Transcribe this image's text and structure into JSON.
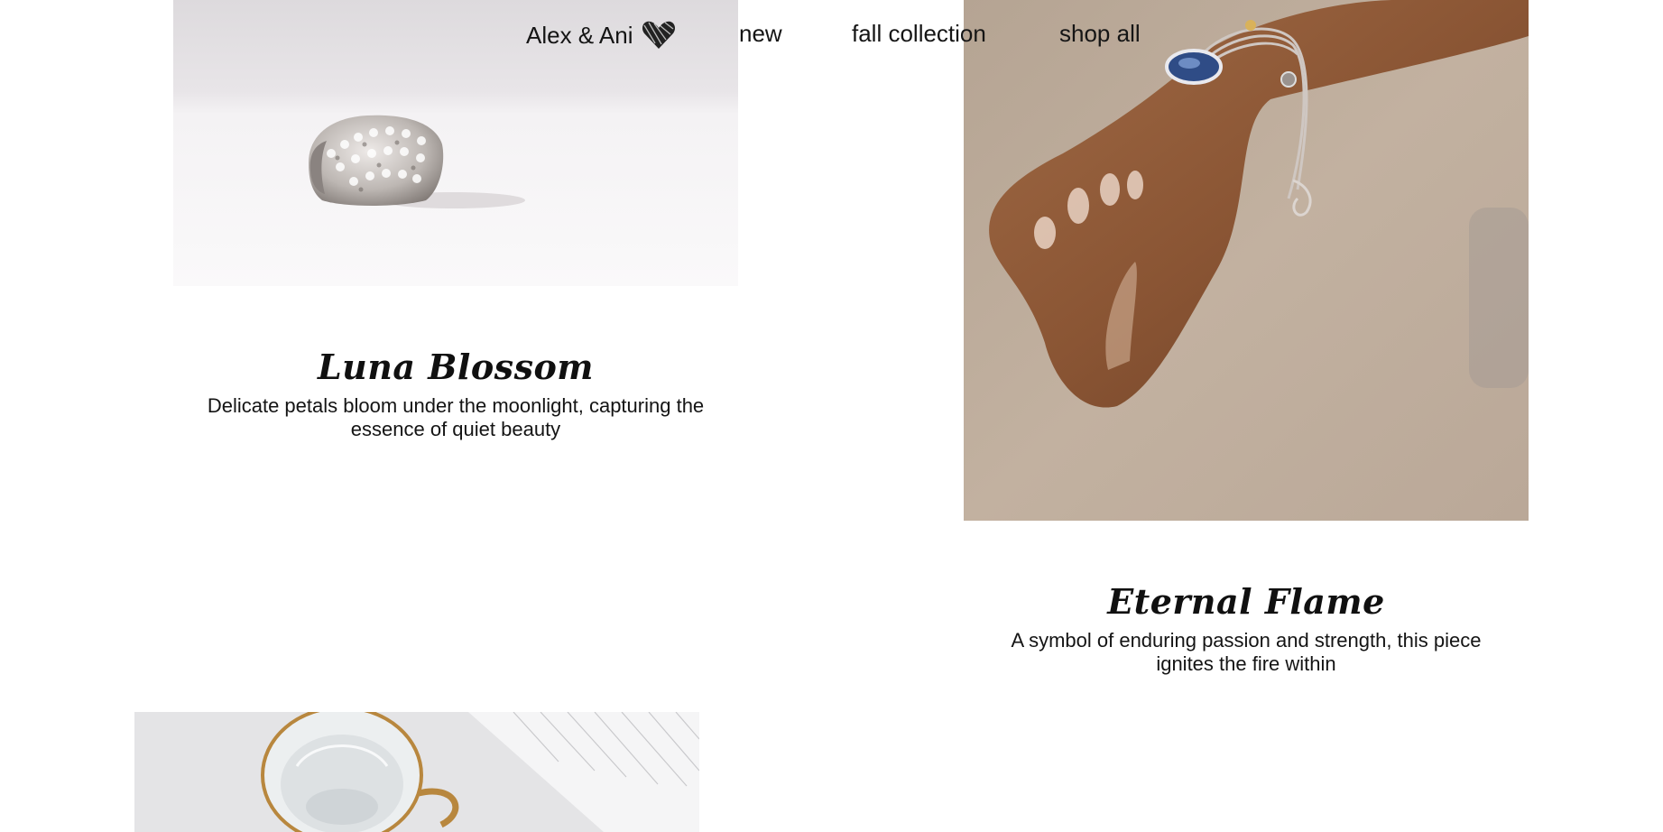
{
  "nav": {
    "brand": "Alex & Ani",
    "brand_icon": "heart-scribble-icon",
    "links": [
      "new",
      "fall collection",
      "shop all"
    ]
  },
  "products": [
    {
      "title": "Luna Blossom",
      "description": "Delicate petals bloom under the moonlight, capturing the essence of quiet beauty",
      "image": "ring-photo"
    },
    {
      "title": "Eternal Flame",
      "description": "A symbol of enduring passion and strength, this piece ignites the fire within",
      "image": "wrist-bracelet-photo"
    },
    {
      "title": "",
      "description": "",
      "image": "glass-cup-photo"
    }
  ]
}
